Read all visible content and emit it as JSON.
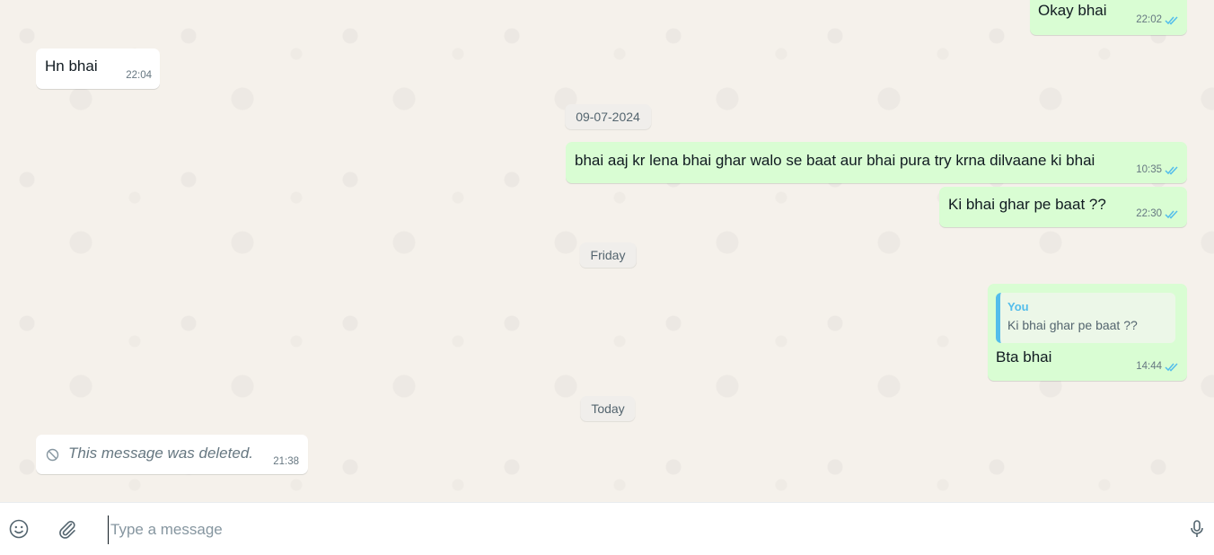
{
  "messages": [
    {
      "id": "m1",
      "direction": "outgoing",
      "text": "Okay bhai",
      "time": "22:02",
      "status": "read"
    },
    {
      "id": "m2",
      "direction": "incoming",
      "text": "Hn bhai",
      "time": "22:04"
    },
    {
      "id": "m3",
      "direction": "outgoing",
      "text": "bhai aaj kr lena bhai ghar walo se baat aur bhai pura try krna dilvaane ki bhai",
      "time": "10:35",
      "status": "read"
    },
    {
      "id": "m4",
      "direction": "outgoing",
      "text": "Ki bhai ghar pe baat ??",
      "time": "22:30",
      "status": "read"
    },
    {
      "id": "m5",
      "direction": "outgoing",
      "text": "Bta bhai",
      "time": "14:44",
      "status": "read",
      "reply_to": {
        "author": "You",
        "text": "Ki bhai ghar pe baat ??"
      }
    },
    {
      "id": "m6",
      "direction": "incoming",
      "deleted": true,
      "text": "This message was deleted.",
      "time": "21:38"
    }
  ],
  "date_separators": [
    "09-07-2024",
    "Friday",
    "Today"
  ],
  "composer": {
    "placeholder": "Type a message",
    "value": "",
    "emoji_icon": "emoji-icon",
    "attach_icon": "attach-icon",
    "mic_icon": "mic-icon"
  },
  "colors": {
    "outgoing_bubble": "#d9fdd3",
    "incoming_bubble": "#ffffff",
    "read_ticks": "#53bdeb",
    "reply_accent": "#53bdeb",
    "chat_background": "#f5f1eb"
  }
}
